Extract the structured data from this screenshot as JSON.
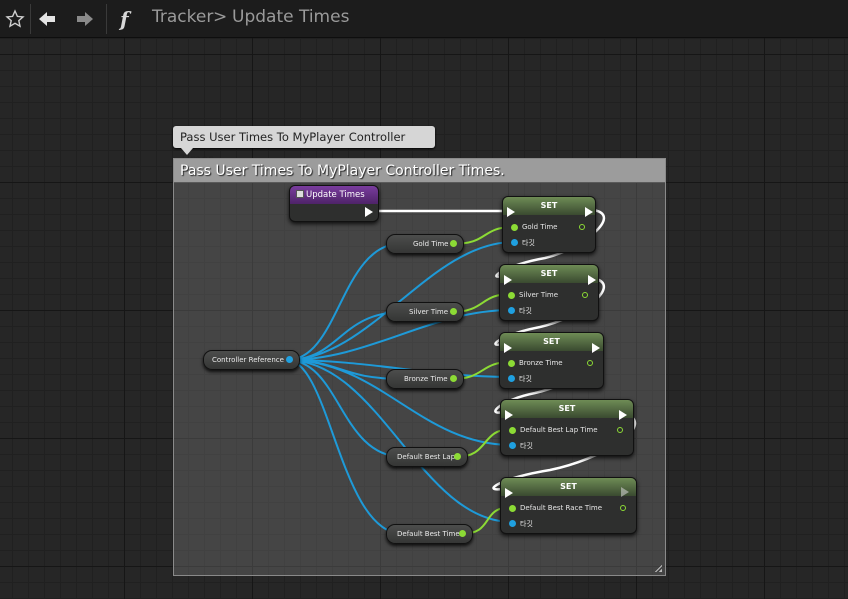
{
  "breadcrumb": {
    "parent": "Tracker",
    "separator": ">",
    "current": "Update Times"
  },
  "comment": {
    "bubble_text": "Pass User Times To MyPlayer Controller Times.",
    "header_text": "Pass User Times To MyPlayer Controller Times."
  },
  "event_node": {
    "label": "Update Times"
  },
  "controller_node": {
    "label": "Controller Reference"
  },
  "get_nodes": [
    {
      "label": "Gold Time"
    },
    {
      "label": "Silver Time"
    },
    {
      "label": "Bronze Time"
    },
    {
      "label": "Default Best Lap"
    },
    {
      "label": "Default Best Time"
    }
  ],
  "set_nodes": [
    {
      "title": "SET",
      "var_label": "Gold Time",
      "target_label": "타깃"
    },
    {
      "title": "SET",
      "var_label": "Silver Time",
      "target_label": "타깃"
    },
    {
      "title": "SET",
      "var_label": "Bronze Time",
      "target_label": "타깃"
    },
    {
      "title": "SET",
      "var_label": "Default Best Lap Time",
      "target_label": "타깃"
    },
    {
      "title": "SET",
      "var_label": "Default Best Race Time",
      "target_label": "타깃"
    }
  ],
  "colors": {
    "float_pin": "#8cdb35",
    "object_pin": "#1fa0e0",
    "exec_pin": "#ffffff",
    "event_header": "#7a3d9e",
    "set_header": "#6e8c55"
  },
  "icons": [
    "star-icon",
    "back-arrow-icon",
    "forward-arrow-icon",
    "function-icon",
    "chevron-right-icon"
  ]
}
